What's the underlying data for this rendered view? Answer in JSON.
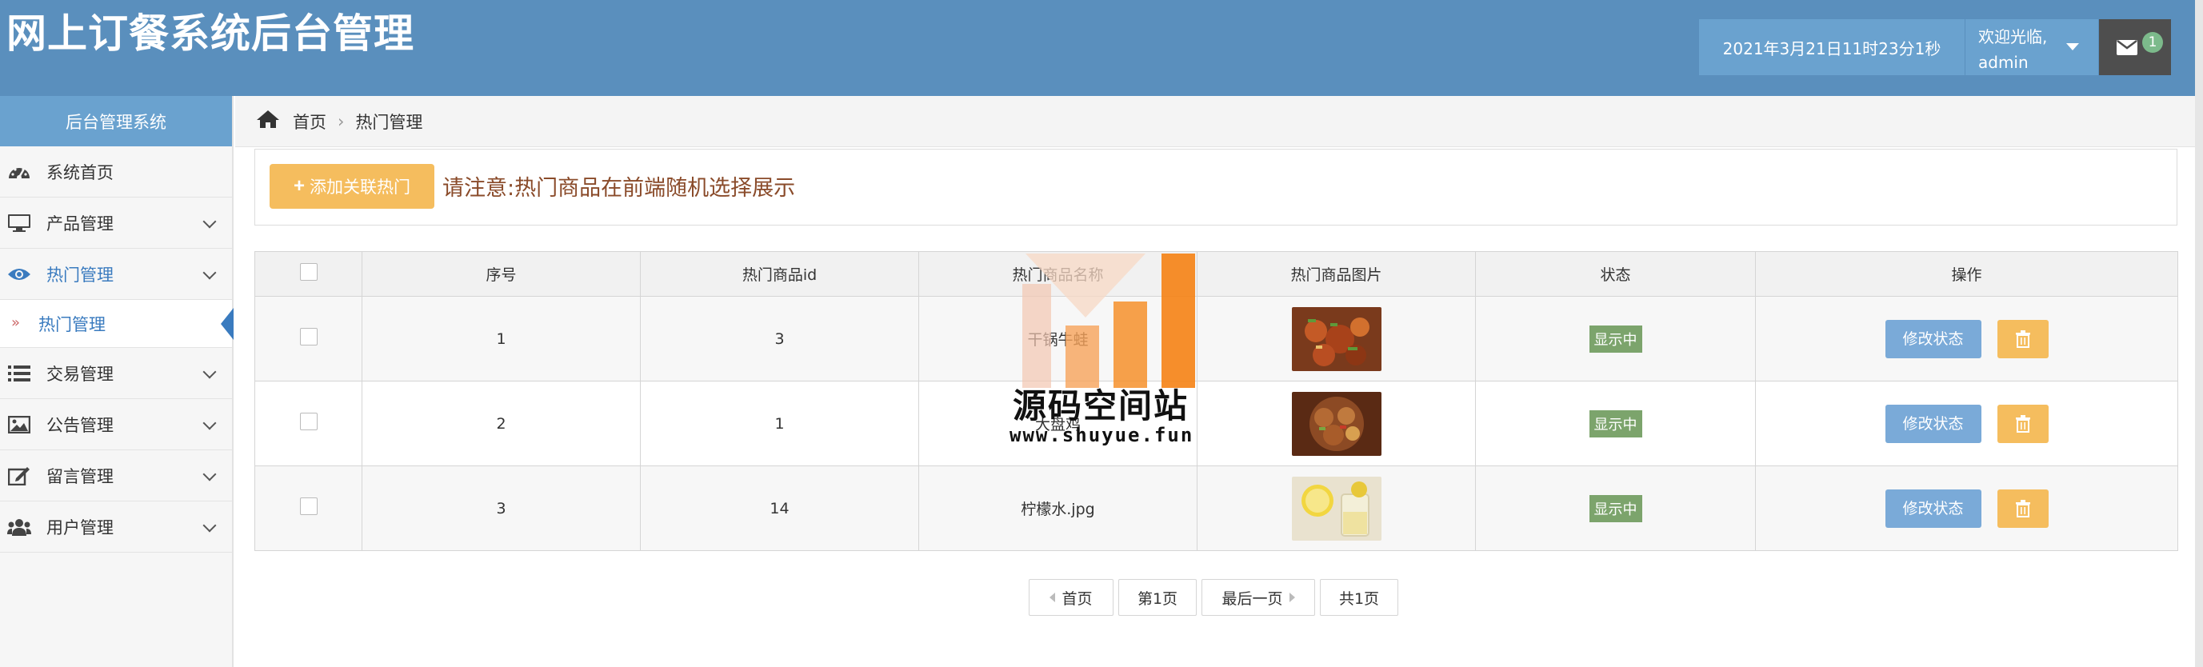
{
  "header": {
    "title": "网上订餐系统后台管理",
    "datetime": "2021年3月21日11时23分1秒",
    "welcome": "欢迎光临,",
    "username": "admin",
    "mail_count": "1"
  },
  "sidebar": {
    "title": "后台管理系统",
    "items": [
      {
        "label": "系统首页",
        "icon": "dashboard-icon"
      },
      {
        "label": "产品管理",
        "icon": "monitor-icon"
      },
      {
        "label": "热门管理",
        "icon": "eye-icon"
      },
      {
        "label": "交易管理",
        "icon": "list-icon"
      },
      {
        "label": "公告管理",
        "icon": "image-icon"
      },
      {
        "label": "留言管理",
        "icon": "edit-icon"
      },
      {
        "label": "用户管理",
        "icon": "users-icon"
      }
    ],
    "active_sub": "热门管理"
  },
  "breadcrumb": {
    "home": "首页",
    "current": "热门管理"
  },
  "toolbar": {
    "add_label": "添加关联热门",
    "notice": "请注意:热门商品在前端随机选择展示"
  },
  "table": {
    "headers": [
      "序号",
      "热门商品id",
      "热门商品名称",
      "热门商品图片",
      "状态",
      "操作"
    ],
    "rows": [
      {
        "seq": "1",
        "id": "3",
        "name": "干锅牛蛙",
        "status": "显示中",
        "edit": "修改状态"
      },
      {
        "seq": "2",
        "id": "1",
        "name": "大盘鸡",
        "status": "显示中",
        "edit": "修改状态"
      },
      {
        "seq": "3",
        "id": "14",
        "name": "柠檬水.jpg",
        "status": "显示中",
        "edit": "修改状态"
      }
    ]
  },
  "pager": {
    "first": "首页",
    "page": "第1页",
    "last": "最后一页",
    "total": "共1页"
  },
  "watermark": {
    "name": "源码空间站",
    "url": "www.shuyue.fun"
  },
  "colors": {
    "header": "#5a8fbd",
    "accent": "#6aa2cf",
    "warning": "#f5bd5e",
    "success": "#7ca46c"
  }
}
